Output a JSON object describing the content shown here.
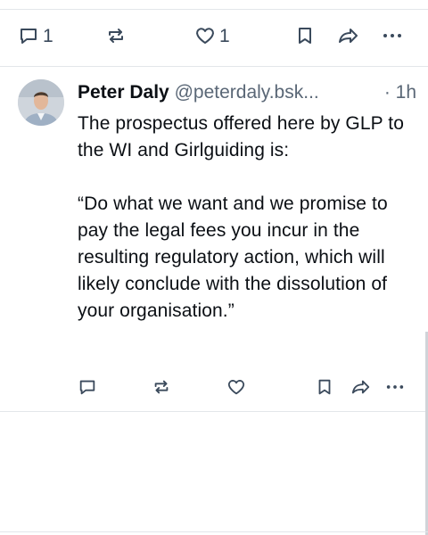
{
  "top_actions": {
    "reply_count": "1",
    "like_count": "1",
    "icons": [
      "reply-icon",
      "repost-icon",
      "like-icon",
      "bookmark-icon",
      "share-icon",
      "more-icon"
    ]
  },
  "post": {
    "author_name": "Peter Daly",
    "author_handle": "@peterdaly.bsk...",
    "time": "· 1h",
    "body": "The prospectus offered here by GLP to the WI and Girlguiding is:\n\n“Do what we want and we promise to pay the legal fees you incur in the resulting regulatory action, which will likely conclude with the dissolution of your organisation.”",
    "avatar_icon": "person-photo"
  },
  "colors": {
    "icon": "#3b4a5c",
    "divider": "#e3e6ea",
    "handle": "#5a6776",
    "text": "#0b0f14"
  }
}
